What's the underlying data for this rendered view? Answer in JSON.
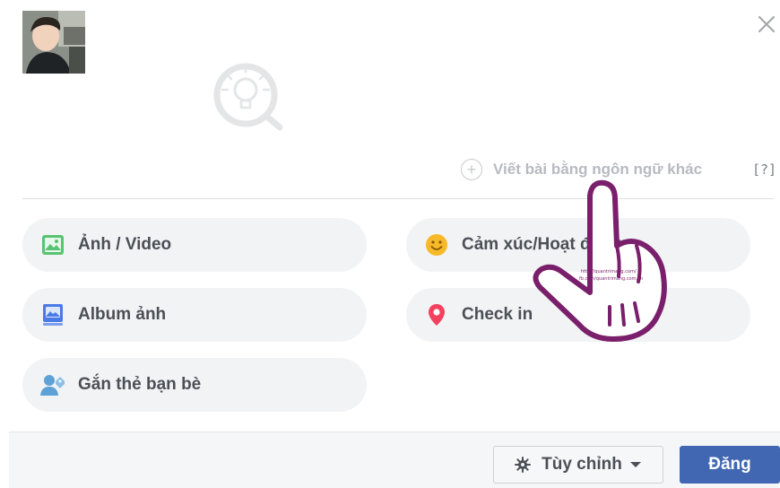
{
  "composer": {
    "watermark_text": "Quantrimang",
    "other_language_link": "Viết bài bằng ngôn ngữ khác",
    "help_link": "[?]",
    "actions": [
      {
        "label": "Ảnh / Video",
        "icon": "photo-video-icon",
        "color": "#58c472"
      },
      {
        "label": "Cảm xúc/Hoạt động",
        "icon": "feeling-emoji-icon",
        "color": "#f7b928"
      },
      {
        "label": "Album ảnh",
        "icon": "photo-album-icon",
        "color": "#4a7be6"
      },
      {
        "label": "Check in",
        "icon": "location-pin-icon",
        "color": "#f3425f"
      },
      {
        "label": "Gắn thẻ bạn bè",
        "icon": "tag-friends-icon",
        "color": "#5ea1d6"
      }
    ],
    "footer": {
      "customize_label": "Tùy chỉnh",
      "post_label": "Đăng"
    },
    "hand_caption_line1": "http://quantrimang.com/",
    "hand_caption_line2": "fb.com/quantrimang.com.vn",
    "accent_color": "#4267b2"
  }
}
